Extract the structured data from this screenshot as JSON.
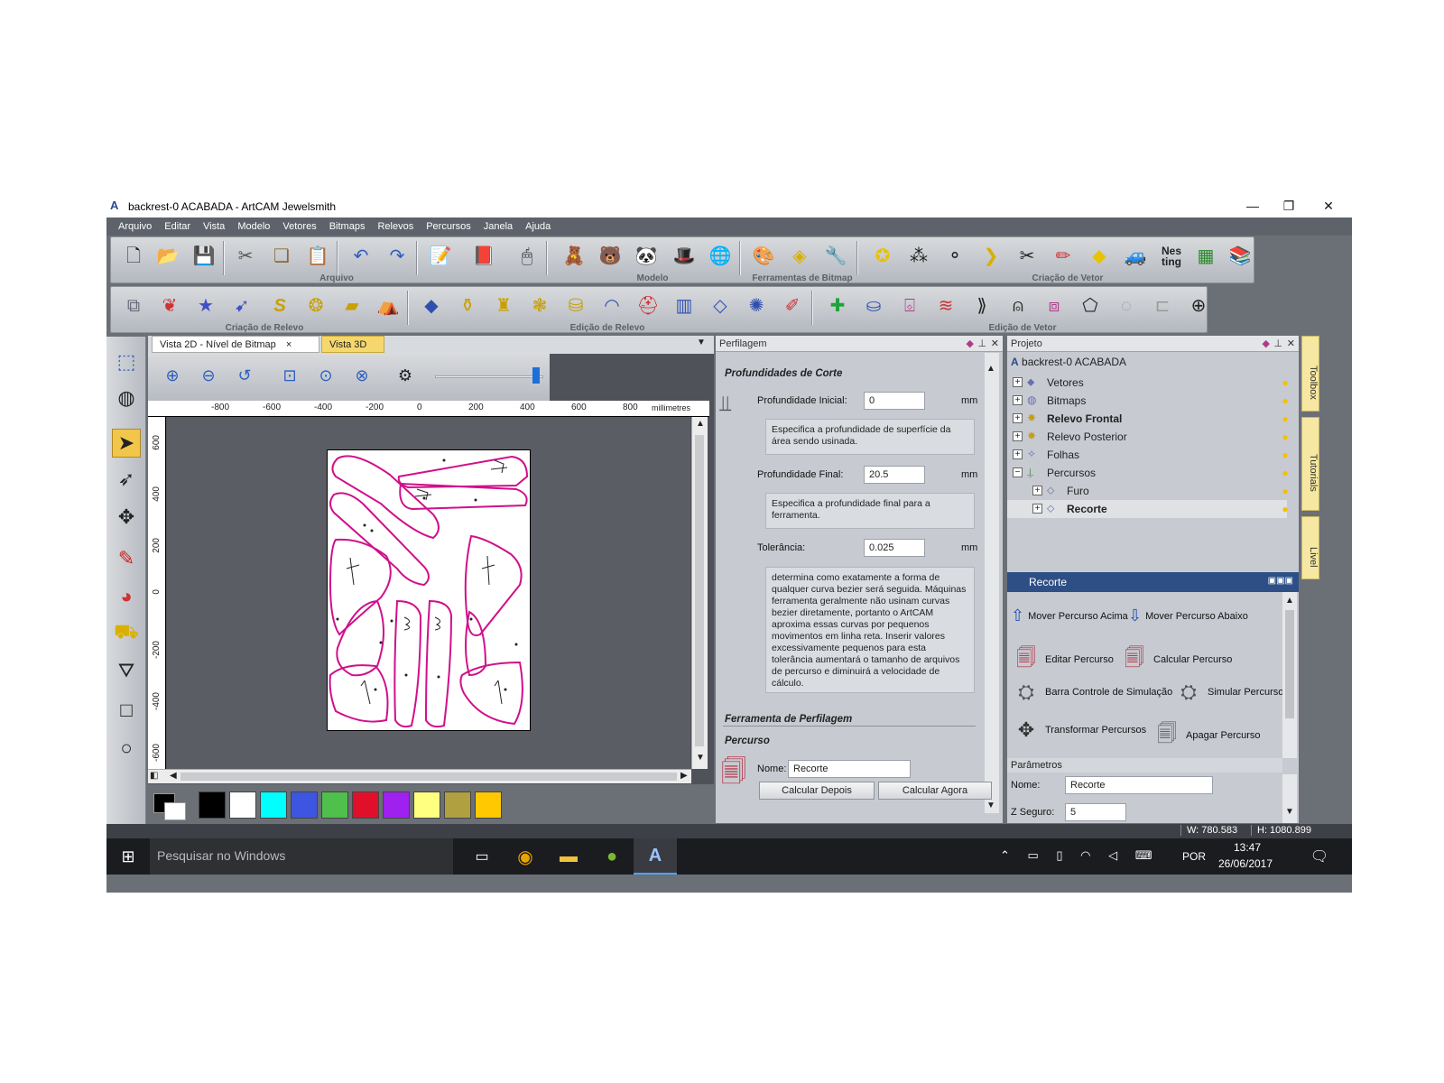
{
  "window": {
    "title": "backrest-0 ACABADA - ArtCAM Jewelsmith",
    "minimize": "—",
    "restore": "❐",
    "close": "✕"
  },
  "menu": [
    "Arquivo",
    "Editar",
    "Vista",
    "Modelo",
    "Vetores",
    "Bitmaps",
    "Relevos",
    "Percursos",
    "Janela",
    "Ajuda"
  ],
  "toolbars": {
    "row1_labels": [
      "Arquivo",
      "Modelo",
      "Ferramentas de Bitmap",
      "Criação de Vetor"
    ],
    "row2_labels": [
      "Criação de Relevo",
      "Edição de Relevo",
      "Edição de Vetor"
    ]
  },
  "view": {
    "tabs": [
      "Vista 2D - Nível de Bitmap",
      "Vista 3D"
    ],
    "tab_close": "×",
    "ruler_units": "millimetres",
    "x_ticks": [
      "-800",
      "-600",
      "-400",
      "-200",
      "0",
      "200",
      "400",
      "600",
      "800"
    ],
    "y_ticks": [
      "600",
      "400",
      "200",
      "0",
      "-200",
      "-400",
      "-600"
    ],
    "zoom_level": 0.95
  },
  "palette": [
    "#000000",
    "#ffffff",
    "#00ffff",
    "#3d55e0",
    "#4ec04b",
    "#e0102a",
    "#a020f0",
    "#ffff80",
    "#b0a040",
    "#ffc800"
  ],
  "perfilagem": {
    "title": "Perfilagem",
    "section_depths": "Profundidades de Corte",
    "initial_label": "Profundidade Inicial:",
    "initial_value": "0",
    "initial_unit": "mm",
    "initial_desc": "Especifica a profundidade de superfície da área sendo usinada.",
    "final_label": "Profundidade Final:",
    "final_value": "20.5",
    "final_unit": "mm",
    "final_desc": "Especifica a profundidade final para a ferramenta.",
    "tol_label": "Tolerância:",
    "tol_value": "0.025",
    "tol_unit": "mm",
    "tol_desc": "determina como exatamente a forma de qualquer curva bezier será seguida. Máquinas ferramenta geralmente não usinam curvas bezier diretamente, portanto o ArtCAM aproxima essas curvas por pequenos movimentos em linha reta. Inserir valores excessivamente pequenos para esta tolerância aumentará o tamanho de arquivos de percurso e diminuirá a velocidade de cálculo.",
    "section_tool": "Ferramenta de Perfilagem",
    "section_path": "Percurso",
    "name_label": "Nome:",
    "name_value": "Recorte",
    "calc_later": "Calcular Depois",
    "calc_now": "Calcular Agora"
  },
  "projeto": {
    "title": "Projeto",
    "root": "backrest-0 ACABADA",
    "items": [
      {
        "label": "Vetores",
        "bold": false,
        "indent": 0
      },
      {
        "label": "Bitmaps",
        "bold": false,
        "indent": 0
      },
      {
        "label": "Relevo Frontal",
        "bold": true,
        "indent": 0
      },
      {
        "label": "Relevo Posterior",
        "bold": false,
        "indent": 0
      },
      {
        "label": "Folhas",
        "bold": false,
        "indent": 0
      },
      {
        "label": "Percursos",
        "bold": false,
        "indent": 0
      },
      {
        "label": "Furo",
        "bold": false,
        "indent": 1
      },
      {
        "label": "Recorte",
        "bold": true,
        "indent": 1
      }
    ],
    "recorte_header": "Recorte",
    "actions": {
      "move_up": "Mover Percurso Acima",
      "move_down": "Mover Percurso Abaixo",
      "edit": "Editar Percurso",
      "calc": "Calcular Percurso",
      "sim_bar": "Barra Controle de Simulação",
      "simulate": "Simular Percurso",
      "transform": "Transformar Percursos",
      "delete": "Apagar Percurso"
    },
    "params_title": "Parâmetros",
    "param_name_label": "Nome:",
    "param_name_value": "Recorte",
    "z_label": "Z Seguro:",
    "z_value": "5"
  },
  "side_tabs": [
    "Toolbox",
    "Tutorials",
    "Livel"
  ],
  "status": {
    "w": "W: 780.583",
    "h": "H: 1080.899"
  },
  "taskbar": {
    "search": "Pesquisar no Windows",
    "lang": "POR",
    "time": "13:47",
    "date": "26/06/2017"
  }
}
